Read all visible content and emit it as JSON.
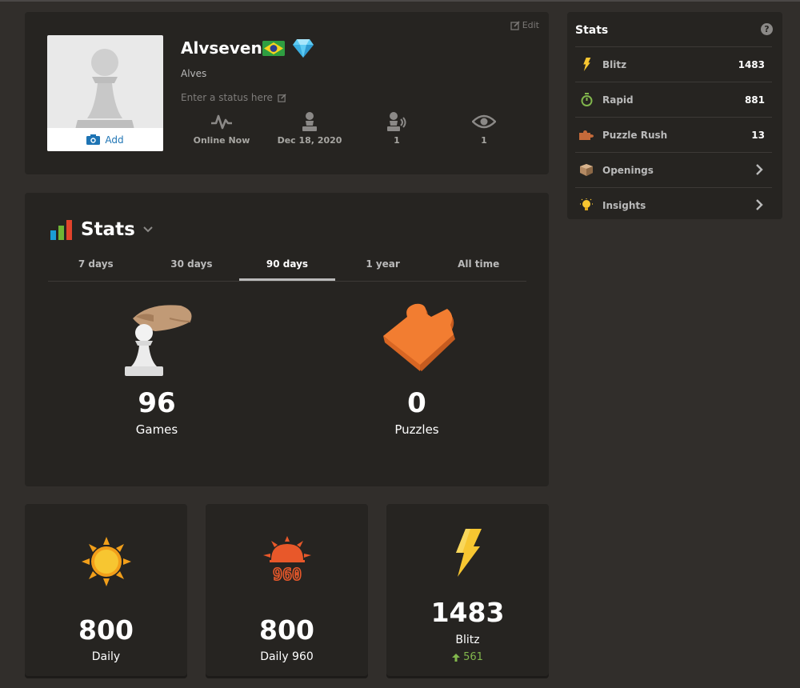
{
  "profile": {
    "edit_label": "Edit",
    "avatar_add_label": "Add",
    "username": "Alvseven",
    "real_name": "Alves",
    "status_placeholder": "Enter a status here",
    "stats": [
      {
        "icon": "activity-pulse-icon",
        "value": "Online Now"
      },
      {
        "icon": "member-since-icon",
        "value": "Dec 18, 2020"
      },
      {
        "icon": "followers-icon",
        "value": "1"
      },
      {
        "icon": "views-eye-icon",
        "value": "1"
      }
    ]
  },
  "stats_card": {
    "title": "Stats",
    "tabs": [
      "7 days",
      "30 days",
      "90 days",
      "1 year",
      "All time"
    ],
    "active_tab": "90 days",
    "games": {
      "value": "96",
      "label": "Games"
    },
    "puzzles": {
      "value": "0",
      "label": "Puzzles"
    }
  },
  "ratings": [
    {
      "label": "Daily",
      "value": "800",
      "icon": "sun-icon"
    },
    {
      "label": "Daily 960",
      "value": "800",
      "icon": "daily-960-icon"
    },
    {
      "label": "Blitz",
      "value": "1483",
      "icon": "lightning-icon",
      "change": "561"
    }
  ],
  "sidebar": {
    "title": "Stats",
    "items": [
      {
        "label": "Blitz",
        "value": "1483",
        "icon": "lightning-icon"
      },
      {
        "label": "Rapid",
        "value": "881",
        "icon": "stopwatch-icon"
      },
      {
        "label": "Puzzle Rush",
        "value": "13",
        "icon": "puzzle-rush-icon"
      },
      {
        "label": "Openings",
        "icon": "openings-book-icon"
      },
      {
        "label": "Insights",
        "icon": "lightbulb-icon"
      }
    ]
  },
  "colors": {
    "background": "#312e2b",
    "panel": "#262421",
    "link_blue": "#1e74b4",
    "rating_up_green": "#81b64c",
    "lightning_yellow": "#f7c631",
    "puzzle_orange": "#f27d31"
  }
}
